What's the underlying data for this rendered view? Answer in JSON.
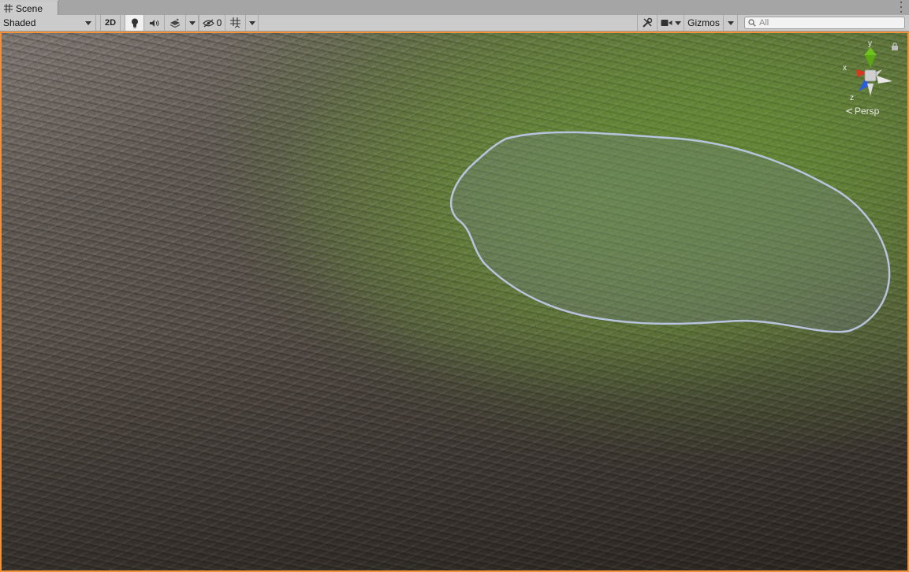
{
  "window": {
    "tab_label": "Scene"
  },
  "toolbar": {
    "shading_mode": "Shaded",
    "two_d_label": "2D",
    "hidden_count": "0",
    "gizmos_label": "Gizmos",
    "search_placeholder": "All"
  },
  "viewport": {
    "projection_label": "Persp",
    "gizmo_axes": {
      "x": "x",
      "y": "y",
      "z": "z"
    },
    "selection_outline_color": "#b8c4dd",
    "frame_color": "#f0913c"
  },
  "colors": {
    "x_axis": "#d9381e",
    "y_axis": "#6fc21e",
    "z_axis": "#2b5fd9"
  }
}
